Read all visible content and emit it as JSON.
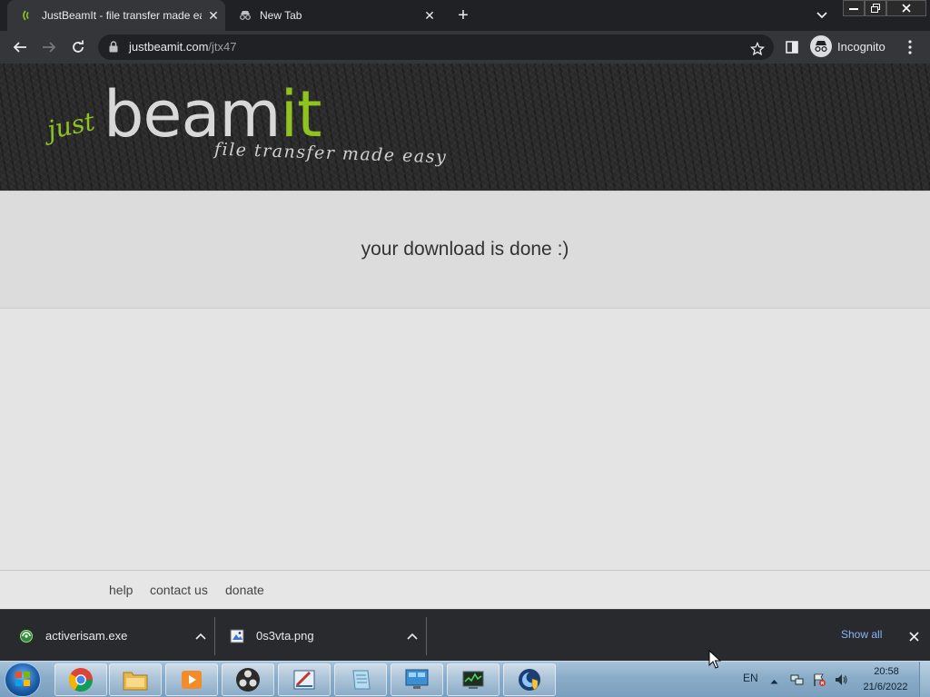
{
  "browser": {
    "tabs": [
      {
        "title": "JustBeamIt - file transfer made ea",
        "active": true,
        "favicon": "beam-signal-icon"
      },
      {
        "title": "New Tab",
        "active": false,
        "favicon": "incognito-icon"
      }
    ],
    "url": {
      "host": "justbeamit.com",
      "path": "/jtx47"
    },
    "profile_label": "Incognito"
  },
  "site": {
    "logo": {
      "just": "just",
      "beam": "beam",
      "it": "it",
      "tagline": "file transfer made easy"
    },
    "status_message": "your download is done :)",
    "footer_links": [
      "help",
      "contact us",
      "donate"
    ]
  },
  "downloads": {
    "items": [
      {
        "filename": "activerisam.exe",
        "icon": "exe-file-icon"
      },
      {
        "filename": "0s3vta.png",
        "icon": "image-file-icon"
      }
    ],
    "show_all_label": "Show all"
  },
  "taskbar": {
    "apps": [
      "chrome",
      "file-explorer",
      "media-player",
      "obs-studio",
      "paint",
      "notepad",
      "control-panel",
      "system-monitor",
      "security-app"
    ],
    "tray": {
      "language": "EN",
      "time": "20:58",
      "date": "21/6/2022"
    }
  },
  "colors": {
    "brand_green": "#8fc31f",
    "link_blue": "#8ab4f8",
    "page_bg": "#e4e4e4"
  }
}
